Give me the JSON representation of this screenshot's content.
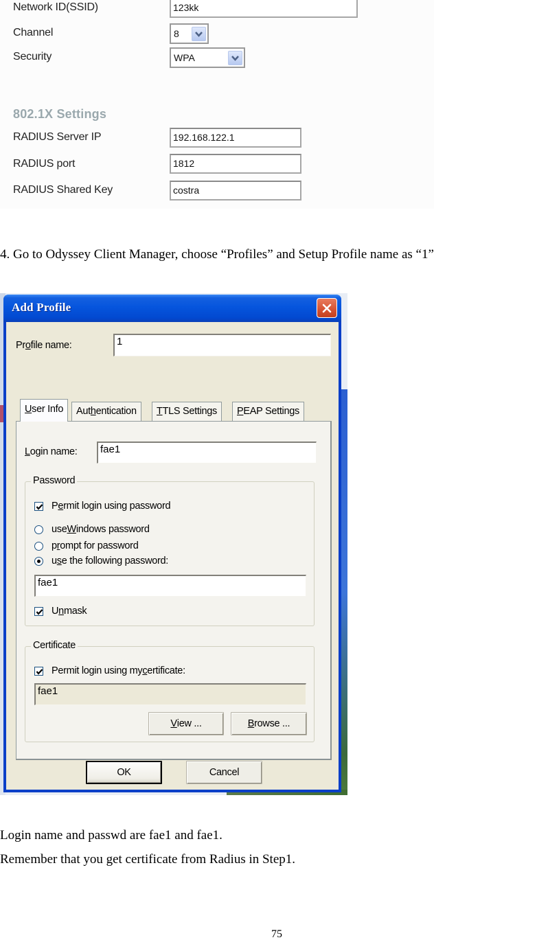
{
  "router_form": {
    "fields": [
      {
        "label": "Network ID(SSID)",
        "value": "123kk"
      },
      {
        "label": "Channel",
        "value": "8"
      },
      {
        "label": "Security",
        "value": "WPA"
      }
    ],
    "section_title": "802.1X Settings",
    "radius_fields": [
      {
        "label": "RADIUS Server IP",
        "value": "192.168.122.1"
      },
      {
        "label": "RADIUS port",
        "value": "1812"
      },
      {
        "label": "RADIUS Shared Key",
        "value": "costra"
      }
    ],
    "accent_color": "#9aa8ad"
  },
  "instructions": {
    "step4": "4. Go to Odyssey Client Manager, choose “Profiles” and Setup Profile name as “1”",
    "note_line1": "Login name and passwd are fae1 and fae1.",
    "note_line2": "Remember that you get certificate from Radius in Step1."
  },
  "dialog": {
    "title": "Add Profile",
    "close_icon": "close-x",
    "profile_name_label_pre": "Pr",
    "profile_name_label_mn": "o",
    "profile_name_label_post": "file name:",
    "profile_name_value": "1",
    "tabs": [
      {
        "pre": "",
        "mn": "U",
        "post": "ser Info",
        "active": true
      },
      {
        "pre": "Aut",
        "mn": "h",
        "post": "entication",
        "active": false
      },
      {
        "pre": "",
        "mn": "T",
        "post": "TLS Settings",
        "active": false
      },
      {
        "pre": "",
        "mn": "P",
        "post": "EAP Settings",
        "active": false
      }
    ],
    "login_label_mn": "L",
    "login_label_post": "ogin name:",
    "login_value": "fae1",
    "password_group": {
      "title": "Password",
      "permit_pre": "P",
      "permit_mn": "e",
      "permit_post": "rmit login using password",
      "permit_checked": true,
      "radio_windows_pre": "use ",
      "radio_windows_mn": "W",
      "radio_windows_post": "indows password",
      "radio_prompt_pre": "p",
      "radio_prompt_mn": "r",
      "radio_prompt_post": "ompt for password",
      "radio_following_pre": "u",
      "radio_following_mn": "s",
      "radio_following_post": "e the following password:",
      "selected": "following",
      "password_value": "fae1",
      "unmask_pre": "U",
      "unmask_mn": "n",
      "unmask_post": "mask",
      "unmask_checked": true
    },
    "certificate_group": {
      "title": "Certificate",
      "permit_pre": "Permit login using my ",
      "permit_mn": "c",
      "permit_post": "ertificate:",
      "permit_checked": true,
      "certificate_value": "fae1",
      "view_mn": "V",
      "view_post": "iew ...",
      "browse_mn": "B",
      "browse_post": "rowse ..."
    },
    "ok_label": "OK",
    "cancel_label": "Cancel"
  },
  "page_number": "75"
}
